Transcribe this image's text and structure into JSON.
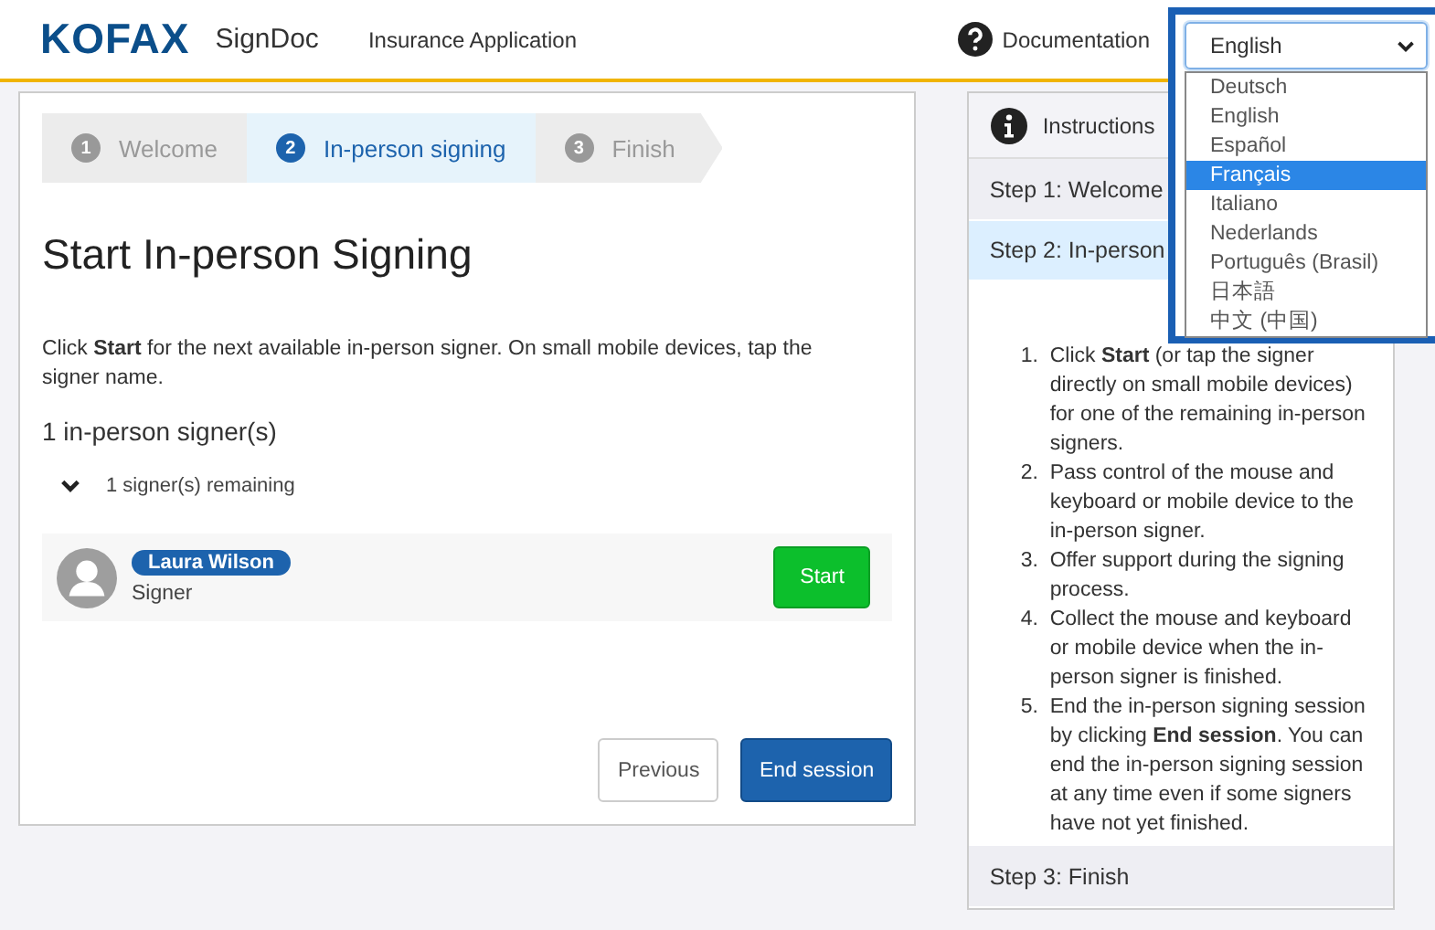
{
  "header": {
    "logo": "KOFAX",
    "product": "SignDoc",
    "app_title": "Insurance Application",
    "documentation": "Documentation",
    "language": {
      "value": "English",
      "expanded": true,
      "options": [
        {
          "label": "Deutsch",
          "highlighted": false
        },
        {
          "label": "English",
          "highlighted": false
        },
        {
          "label": "Español",
          "highlighted": false
        },
        {
          "label": "Français",
          "highlighted": true
        },
        {
          "label": "Italiano",
          "highlighted": false
        },
        {
          "label": "Nederlands",
          "highlighted": false
        },
        {
          "label": "Português (Brasil)",
          "highlighted": false
        },
        {
          "label": "日本語",
          "highlighted": false
        },
        {
          "label": "中文 (中国)",
          "highlighted": false
        }
      ]
    }
  },
  "steps": [
    {
      "number": "1",
      "label": "Welcome",
      "selected": false
    },
    {
      "number": "2",
      "label": "In-person signing",
      "selected": true
    },
    {
      "number": "3",
      "label": "Finish",
      "selected": false
    }
  ],
  "title": "Start In-person Signing",
  "intro": "Click **Start** for the next available in-person signer. On small mobile devices, tap the signer name.",
  "signer_count": "1 in-person signer(s)",
  "group": {
    "label": "1 signer(s) remaining",
    "expanded": true
  },
  "signers": [
    {
      "name": "Laura Wilson",
      "role": "Signer",
      "action": "Start"
    }
  ],
  "buttons": [
    {
      "label": "Previous",
      "kind": "secondary"
    },
    {
      "label": "End session",
      "kind": "primary"
    }
  ],
  "instructions": {
    "title": "Instructions",
    "sections": [
      {
        "label": "Step 1: Welcome",
        "expanded": false
      },
      {
        "label": "Step 2: In-person",
        "expanded": true,
        "items": [
          {
            "number": "1.",
            "text": "Click **Start** (or tap the signer directly on small mobile devices) for one of the remaining in-person signers."
          },
          {
            "number": "2.",
            "text": "Pass control of the mouse and keyboard or mobile device to the in-person signer."
          },
          {
            "number": "3.",
            "text": "Offer support during the signing process."
          },
          {
            "number": "4.",
            "text": "Collect the mouse and keyboard or mobile device when the in-person signer is finished."
          },
          {
            "number": "5.",
            "text": "End the in-person signing session by clicking **End session**. You can end the in-person signing session at any time even if some signers have not yet finished."
          }
        ]
      },
      {
        "label": "Step 3: Finish",
        "expanded": false
      }
    ]
  }
}
